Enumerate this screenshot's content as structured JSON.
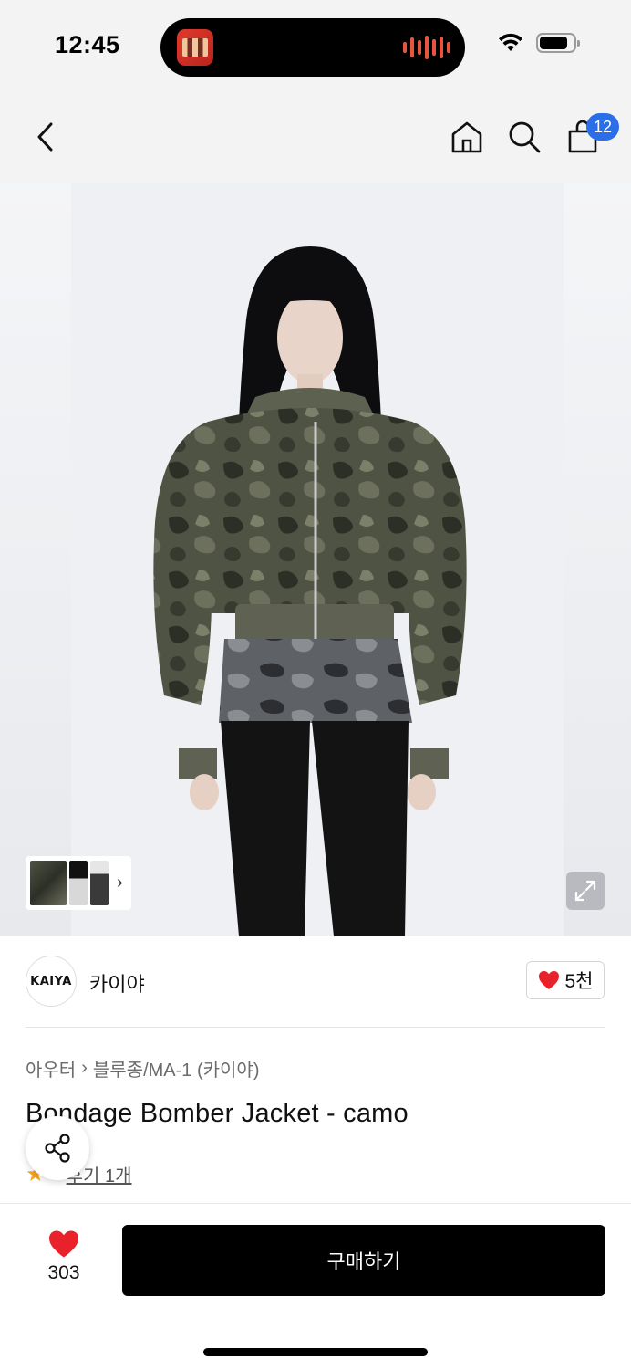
{
  "status_bar": {
    "time": "12:45"
  },
  "nav": {
    "cart_count": "12",
    "icons": [
      "back-icon",
      "home-icon",
      "search-icon",
      "cart-icon"
    ]
  },
  "product_image": {
    "thumbnail_count": 3,
    "chevron": "›"
  },
  "brand": {
    "logo_text": "KAIYA",
    "name": "카이야",
    "like_count": "5천"
  },
  "breadcrumb": {
    "category": "아우터",
    "separator": "›",
    "subcategory": "블루종/MA-1 (카이야)"
  },
  "product": {
    "title": "Bondage Bomber Jacket - camo",
    "rating": "5",
    "review_text": "후기 1개"
  },
  "bottom_bar": {
    "wish_count": "303",
    "buy_label": "구매하기"
  },
  "colors": {
    "badge": "#2a6fe8",
    "heart": "#e8212b",
    "star": "#f5a623",
    "buy_button": "#000000"
  }
}
